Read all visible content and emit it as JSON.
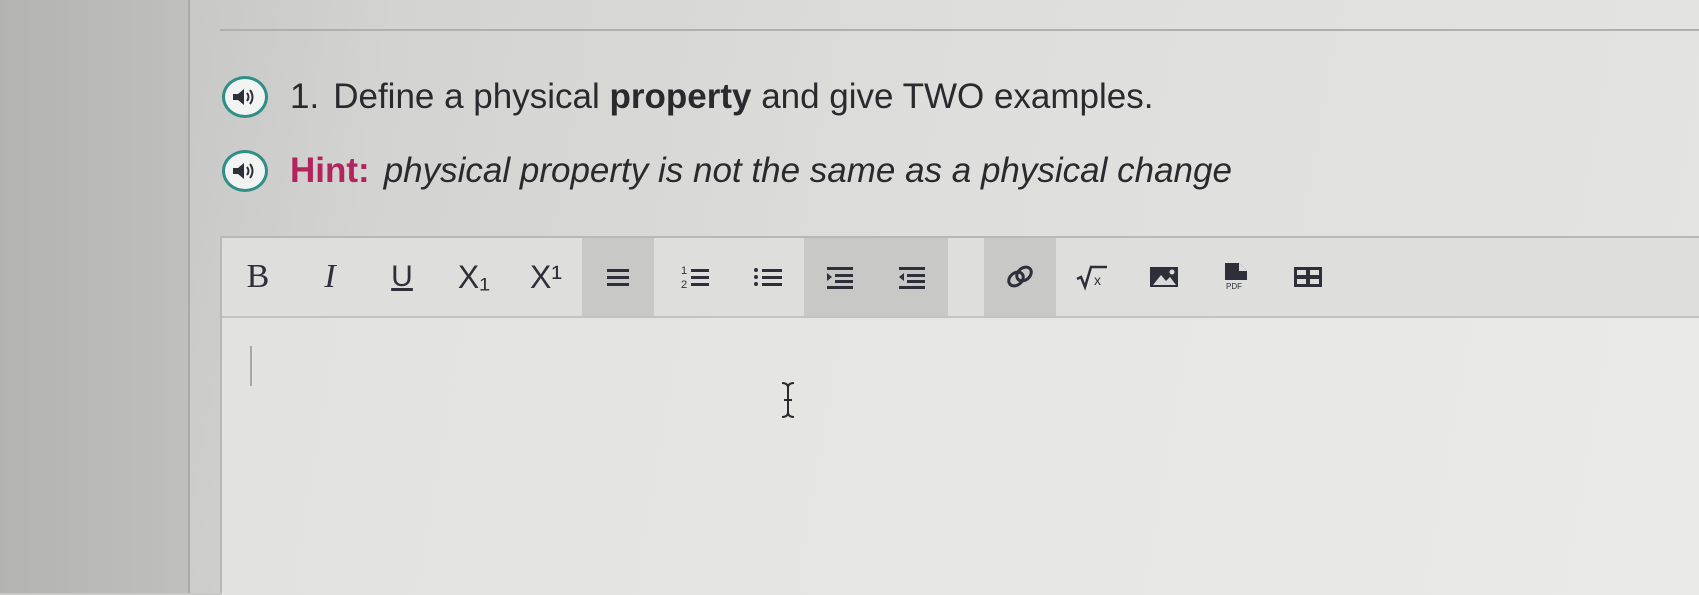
{
  "question": {
    "number": "1.",
    "text_before": "Define a physical",
    "text_bold": "property",
    "text_after": "and give TWO examples."
  },
  "hint": {
    "label": "Hint:",
    "text": "physical property is not the same as a physical change"
  },
  "toolbar": {
    "bold_label": "B",
    "italic_label": "I",
    "underline_label": "U",
    "subscript_label": "X₁",
    "superscript_label": "X¹",
    "pdf_label": "PDF"
  },
  "editor": {
    "value": ""
  },
  "colors": {
    "speaker_accent": "#2f8f86",
    "hint_label": "#b3245e"
  },
  "icons": [
    "speaker-icon",
    "bold-icon",
    "italic-icon",
    "underline-icon",
    "subscript-icon",
    "superscript-icon",
    "align-icon",
    "numbered-list-icon",
    "bullet-list-icon",
    "indent-icon",
    "outdent-icon",
    "link-icon",
    "math-equation-icon",
    "image-icon",
    "pdf-icon",
    "table-icon"
  ]
}
